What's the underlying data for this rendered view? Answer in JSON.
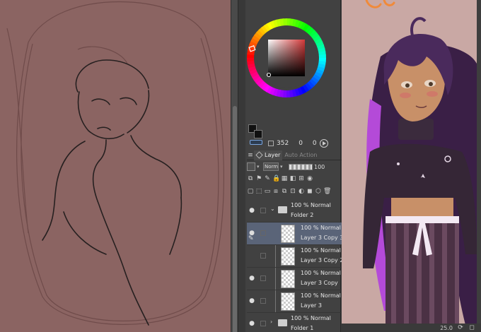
{
  "brush_info": {
    "size": "352",
    "val1": "0",
    "val2": "0"
  },
  "tabs": [
    {
      "label": "Layer",
      "active": true
    },
    {
      "label": "Auto Action",
      "active": false
    }
  ],
  "layer_props": {
    "blend_mode": "Norma",
    "opacity": "100"
  },
  "layers": [
    {
      "kind": "folder",
      "line1": "100 % Normal",
      "line2": "Folder 2",
      "visible": true,
      "expanded": true
    },
    {
      "kind": "layer",
      "line1": "100 % Normal",
      "line2": "Layer 3 Copy 3",
      "visible": true,
      "selected": true
    },
    {
      "kind": "layer",
      "line1": "100 % Normal",
      "line2": "Layer 3 Copy 2",
      "visible": false
    },
    {
      "kind": "layer",
      "line1": "100 % Normal",
      "line2": "Layer 3 Copy",
      "visible": true
    },
    {
      "kind": "layer",
      "line1": "100 % Normal",
      "line2": "Layer 3",
      "visible": true
    },
    {
      "kind": "folder",
      "line1": "100 % Normal",
      "line2": "Folder 1",
      "visible": true,
      "expanded": false
    }
  ],
  "status": {
    "zoom": "25.0"
  },
  "colors": {
    "canvas_left": "#8b6462",
    "canvas_right": "#c9a8a4",
    "panel": "#414141",
    "selected_layer": "#5a6478"
  }
}
